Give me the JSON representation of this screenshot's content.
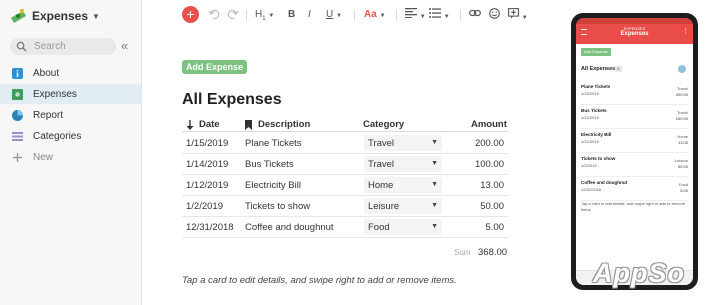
{
  "app": {
    "name": "Expenses"
  },
  "sidebar": {
    "search_placeholder": "Search",
    "items": [
      {
        "label": "About",
        "icon": "info-icon"
      },
      {
        "label": "Expenses",
        "icon": "money-icon",
        "active": true
      },
      {
        "label": "Report",
        "icon": "report-icon"
      },
      {
        "label": "Categories",
        "icon": "list-icon"
      },
      {
        "label": "New",
        "icon": "plus-icon"
      }
    ]
  },
  "toolbar": {
    "heading": "H",
    "heading_sub": "1",
    "bold": "B",
    "italic": "I",
    "underline": "U",
    "font": "Aa",
    "accent_color": "#e9524c"
  },
  "main": {
    "add_button": "Add Expense",
    "title": "All Expenses",
    "columns": [
      "Date",
      "Description",
      "Category",
      "Amount"
    ],
    "rows": [
      {
        "date": "1/15/2019",
        "description": "Plane Tickets",
        "category": "Travel",
        "amount": "200.00"
      },
      {
        "date": "1/14/2019",
        "description": "Bus Tickets",
        "category": "Travel",
        "amount": "100.00"
      },
      {
        "date": "1/12/2019",
        "description": "Electricity Bill",
        "category": "Home",
        "amount": "13.00"
      },
      {
        "date": "1/2/2019",
        "description": "Tickets to show",
        "category": "Leisure",
        "amount": "50.00"
      },
      {
        "date": "12/31/2018",
        "description": "Coffee and doughnut",
        "category": "Food",
        "amount": "5.00"
      }
    ],
    "sum_label": "Sum",
    "sum_value": "368.00",
    "hint": "Tap a card to edit details, and swipe right to add or remove items."
  },
  "phone": {
    "app_name": "EXPENSES",
    "page_title": "Expenses",
    "add_button": "Add Expense",
    "list_title": "All Expenses",
    "count_badge": "5",
    "cards": [
      {
        "description": "Plane Tickets",
        "date": "1/15/2019",
        "category": "Travel",
        "amount": "200.00"
      },
      {
        "description": "Bus Tickets",
        "date": "1/14/2019",
        "category": "Travel",
        "amount": "100.00"
      },
      {
        "description": "Electricity Bill",
        "date": "1/12/2019",
        "category": "Home",
        "amount": "13.00"
      },
      {
        "description": "Tickets to show",
        "date": "1/2/2019",
        "category": "Leisure",
        "amount": "50.00"
      },
      {
        "description": "Coffee and doughnut",
        "date": "12/31/2018",
        "category": "Food",
        "amount": "5.00"
      }
    ],
    "hint": "Tap a card to edit details, and swipe right to add or remove items."
  },
  "watermark": "AppSo"
}
